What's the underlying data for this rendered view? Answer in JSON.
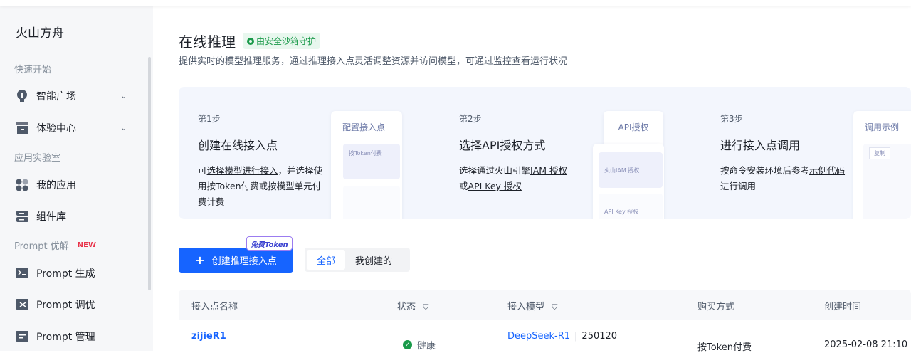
{
  "sidebar": {
    "brand": "火山方舟",
    "sections": [
      "快速开始",
      "应用实验室",
      "Prompt 优解"
    ],
    "new_badge": "NEW",
    "items": [
      {
        "label": "智能广场",
        "icon": "bulb-icon"
      },
      {
        "label": "体验中心",
        "icon": "box-icon"
      },
      {
        "label": "我的应用",
        "icon": "apps-icon"
      },
      {
        "label": "组件库",
        "icon": "database-icon"
      },
      {
        "label": "Prompt 生成",
        "icon": "terminal-icon"
      },
      {
        "label": "Prompt 调优",
        "icon": "tune-icon"
      },
      {
        "label": "Prompt 管理",
        "icon": "manage-icon"
      }
    ]
  },
  "header": {
    "title": "在线推理",
    "badge": "由安全沙箱守护",
    "description": "提供实时的模型推理服务，通过推理接入点灵活调整资源并访问模型，可通过监控查看运行状况"
  },
  "steps": [
    {
      "num": "第1步",
      "title": "创建在线接入点",
      "d1": "可",
      "link1": "选择模型进行接入",
      "d2": "，并选择使用按Token付费或按模型单元付费计费",
      "card": "配置接入点",
      "mini": "按Token付费"
    },
    {
      "num": "第2步",
      "title": "选择API授权方式",
      "d1": "选择通过火山引擎",
      "link1": "IAM 授权",
      "d2": "或",
      "link2": "API Key 授权",
      "card": "API授权",
      "mini": "火山IAM 授权",
      "mini2": "API Key 授权"
    },
    {
      "num": "第3步",
      "title": "进行接入点调用",
      "d1": "按命令安装环境后参考",
      "link1": "示例代码",
      "d2": "进行调用",
      "card": "调用示例",
      "mini": "复制"
    }
  ],
  "actions": {
    "create": "创建推理接入点",
    "free_tag": "免费Token",
    "tabs": [
      "全部",
      "我创建的"
    ]
  },
  "table": {
    "headers": [
      "接入点名称",
      "状态",
      "接入模型",
      "购买方式",
      "创建时间"
    ],
    "rows": [
      {
        "name": "zijieR1",
        "status": "健康",
        "model": "DeepSeek-R1",
        "version": "250120",
        "purchase": "按Token付费",
        "created": "2025-02-08 21:10"
      }
    ]
  },
  "colors": {
    "primary": "#1664ff",
    "success": "#1a9a4a"
  }
}
